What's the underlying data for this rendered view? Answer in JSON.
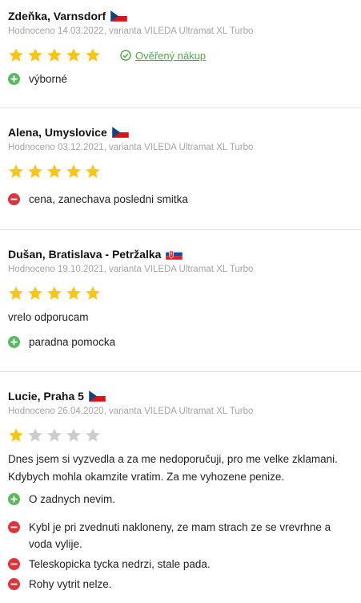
{
  "reviews": [
    {
      "author": "Zdeňka, Varnsdorf",
      "flag": "cz-flag-icon",
      "meta": "Hodnoceno 14.03.2022, varianta VILEDA Ultramat XL Turbo",
      "rating": 5,
      "verified_label": "Ověřený nákup",
      "pros": [
        "výborné"
      ],
      "cons": []
    },
    {
      "author": "Alena, Umyslovice",
      "flag": "cz-flag-icon",
      "meta": "Hodnoceno 03.12.2021, varianta VILEDA Ultramat XL Turbo",
      "rating": 5,
      "pros": [],
      "cons": [
        "cena, zanechava posledni smitka"
      ]
    },
    {
      "author": "Dušan, Bratislava - Petržalka",
      "flag": "sk-flag-icon",
      "meta": "Hodnoceno 19.10.2021, varianta VILEDA Ultramat XL Turbo",
      "rating": 5,
      "text": "vrelo odporucam",
      "pros": [
        "paradna pomocka"
      ],
      "cons": []
    },
    {
      "author": "Lucie, Praha 5",
      "flag": "cz-flag-icon",
      "meta": "Hodnoceno 26.04.2020, varianta VILEDA Ultramat XL Turbo",
      "rating": 1,
      "text": "Dnes jsem si vyzvedla a za me nedoporučuji, pro me velke zklamani. Kdybych mohla okamzite vratim. Za me vyhozene penize.",
      "pros": [
        "O zadnych nevim."
      ],
      "cons": [
        "Kybl je pri zvednuti nakloneny, ze mam strach ze se vrevrhne a voda vylije.",
        "Teleskopicka tycka nedrzi, stale pada.",
        "Rohy vytrit nelze."
      ]
    }
  ],
  "colors": {
    "star_filled": "#f5c518",
    "star_empty": "#cccccc",
    "verified": "#4ea84a",
    "pro": "#5cb85c",
    "con": "#d9363e"
  }
}
